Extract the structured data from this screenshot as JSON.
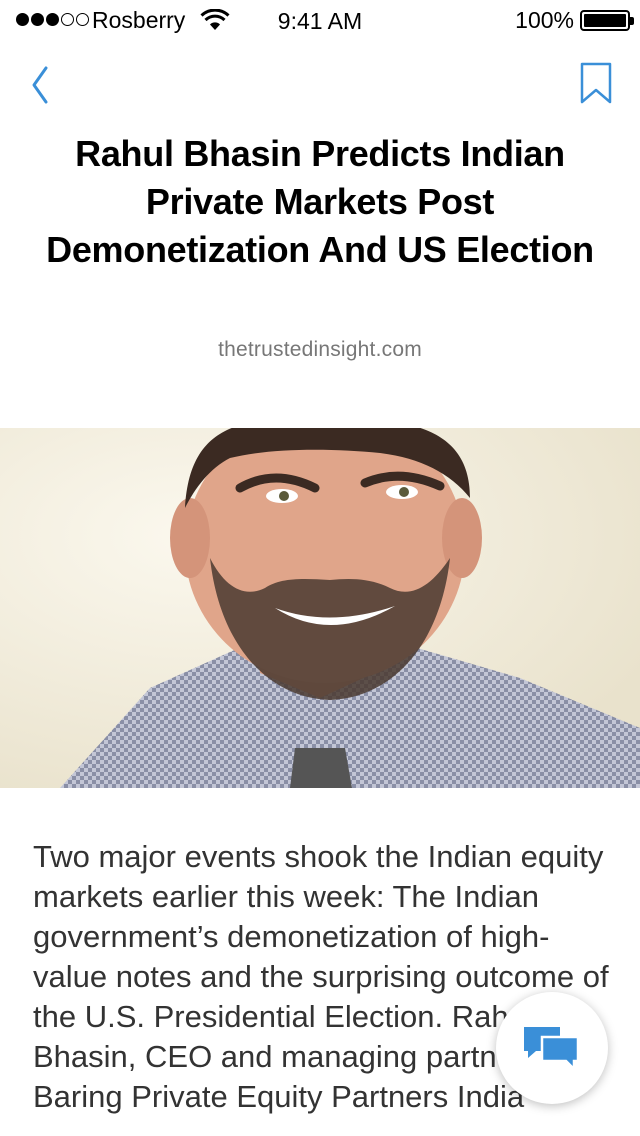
{
  "status_bar": {
    "carrier": "Rosberry",
    "time": "9:41 AM",
    "battery": "100%"
  },
  "nav": {
    "back_icon": "chevron-left-icon",
    "bookmark_icon": "bookmark-icon",
    "accent_color": "#3a8fd8"
  },
  "article": {
    "title": "Rahul Bhasin Predicts Indian Private Markets Post Demonetization And US Election",
    "source": "thetrustedinsight.com",
    "image_alt": "portrait-photo",
    "body": "Two major events shook the Indian equity markets earlier this week: The Indian government’s demonetization of high-value notes and the surprising outcome of the U.S. Presidential Election. Rahul Bhasin, CEO and managing partner at Baring Private Equity Partners India"
  },
  "chat_button": {
    "icon": "chat-bubbles-icon",
    "color": "#3a8fd8"
  }
}
